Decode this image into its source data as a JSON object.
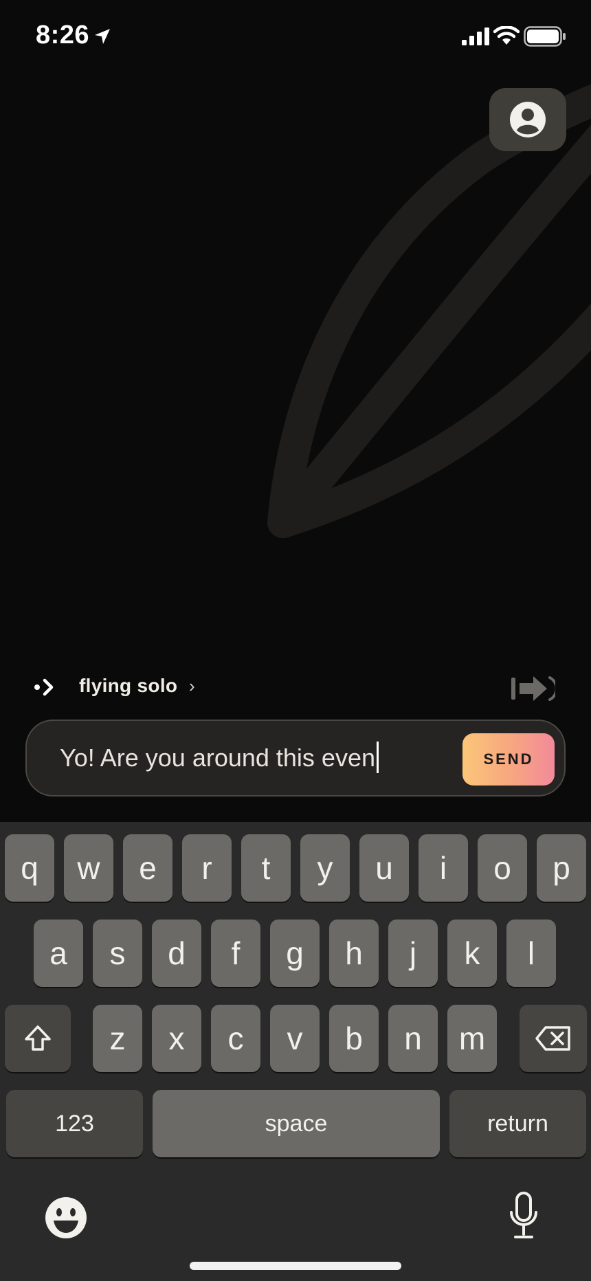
{
  "status_bar": {
    "time": "8:26",
    "icons": [
      "location-arrow-icon",
      "cellular-signal-icon",
      "wifi-icon",
      "battery-icon"
    ]
  },
  "profile": {
    "icon": "user-avatar-icon"
  },
  "mode": {
    "icon": "dot-arrow-icon",
    "label": "flying solo",
    "chevron": "›",
    "exit_icon": "exit-arrow-icon"
  },
  "composer": {
    "text": "Yo! Are you around this even",
    "send_label": "SEND",
    "send_gradient": [
      "#fbc679",
      "#f28a9a"
    ]
  },
  "keyboard": {
    "row1": [
      "q",
      "w",
      "e",
      "r",
      "t",
      "y",
      "u",
      "i",
      "o",
      "p"
    ],
    "row2": [
      "a",
      "s",
      "d",
      "f",
      "g",
      "h",
      "j",
      "k",
      "l"
    ],
    "row3": [
      "z",
      "x",
      "c",
      "v",
      "b",
      "n",
      "m"
    ],
    "numbers_label": "123",
    "space_label": "space",
    "return_label": "return",
    "shift_icon": "shift-icon",
    "delete_icon": "backspace-icon",
    "emoji_icon": "emoji-icon",
    "mic_icon": "microphone-icon"
  },
  "colors": {
    "background": "#0a0a0a",
    "key": "#6b6a66",
    "function_key": "#464542",
    "keyboard_bg": "#2a2a2a"
  }
}
